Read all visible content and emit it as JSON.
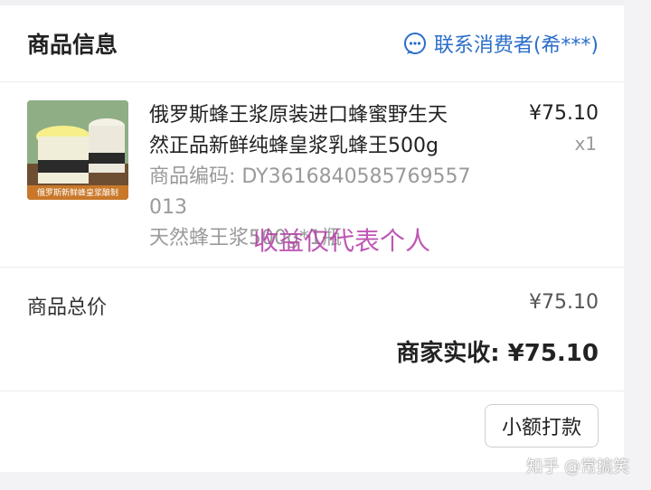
{
  "header": {
    "section_title": "商品信息",
    "contact_label": "联系消费者(希***)"
  },
  "product": {
    "title_line1": "俄罗斯蜂王浆原装进口蜂蜜野生天",
    "title_line2": "然正品新鲜纯蜂皇浆乳蜂王500g",
    "code_line1": "商品编码: DY3616840585769557",
    "code_line2": "013",
    "spec": "天然蜂王浆500g*1瓶",
    "price": "¥75.10",
    "quantity": "x1",
    "thumb_caption": "俄罗斯新鲜蜂皇浆酿制"
  },
  "totals": {
    "label": "商品总价",
    "value": "¥75.10",
    "actual_label": "商家实收:",
    "actual_value": "¥75.10"
  },
  "footer": {
    "button": "小额打款"
  },
  "watermarks": {
    "center": "收益仅代表个人",
    "corner": "知乎 @常搞笑"
  },
  "colors": {
    "accent": "#2b6ec9",
    "watermark": "#b53aa8"
  }
}
